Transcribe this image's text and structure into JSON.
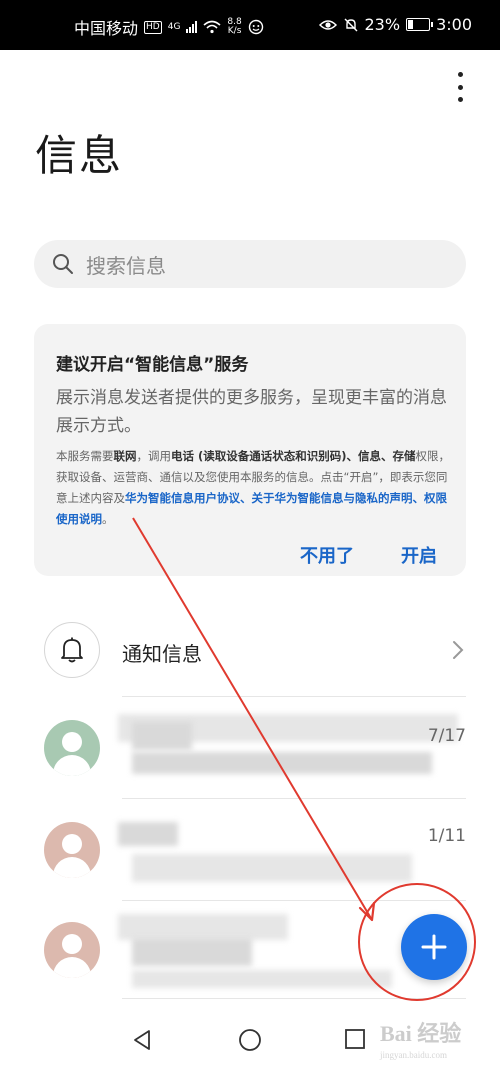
{
  "status_bar": {
    "carrier": "中国移动",
    "hd": "HD",
    "network": "4G",
    "speed_value": "8.8",
    "speed_unit": "K/s",
    "battery": "23%",
    "time": "3:00"
  },
  "header": {
    "title": "信息"
  },
  "search": {
    "placeholder": "搜索信息"
  },
  "smart_card": {
    "title": "建议开启“智能信息”服务",
    "description": "展示消息发送者提供的更多服务，呈现更丰富的消息展示方式。",
    "legal": {
      "p1": "本服务需要",
      "b1": "联网",
      "p2": "，调用",
      "b2": "电话 (读取设备通话状态和识别码)、信息、存储",
      "p3": "权限，获取设备、运营商、通信以及您使用本服务的信息。点击“开启”，即表示您同意上述内容及",
      "link": "华为智能信息用户协议、关于华为智能信息与隐私的声明、权限使用说明",
      "p4": "。"
    },
    "decline_label": "不用了",
    "accept_label": "开启"
  },
  "notification_row": {
    "label": "通知信息"
  },
  "conversations": [
    {
      "date": "7/17",
      "avatar_color": "#a8c9b2"
    },
    {
      "date": "1/11",
      "avatar_color": "#dcb9ae"
    },
    {
      "date": "",
      "avatar_color": "#dcb9ae"
    }
  ],
  "colors": {
    "accent": "#1f73e6",
    "link": "#1a66c8",
    "annotation": "#e03a2f"
  },
  "watermark": {
    "text": "Bai 经验",
    "url": "jingyan.baidu.com"
  }
}
